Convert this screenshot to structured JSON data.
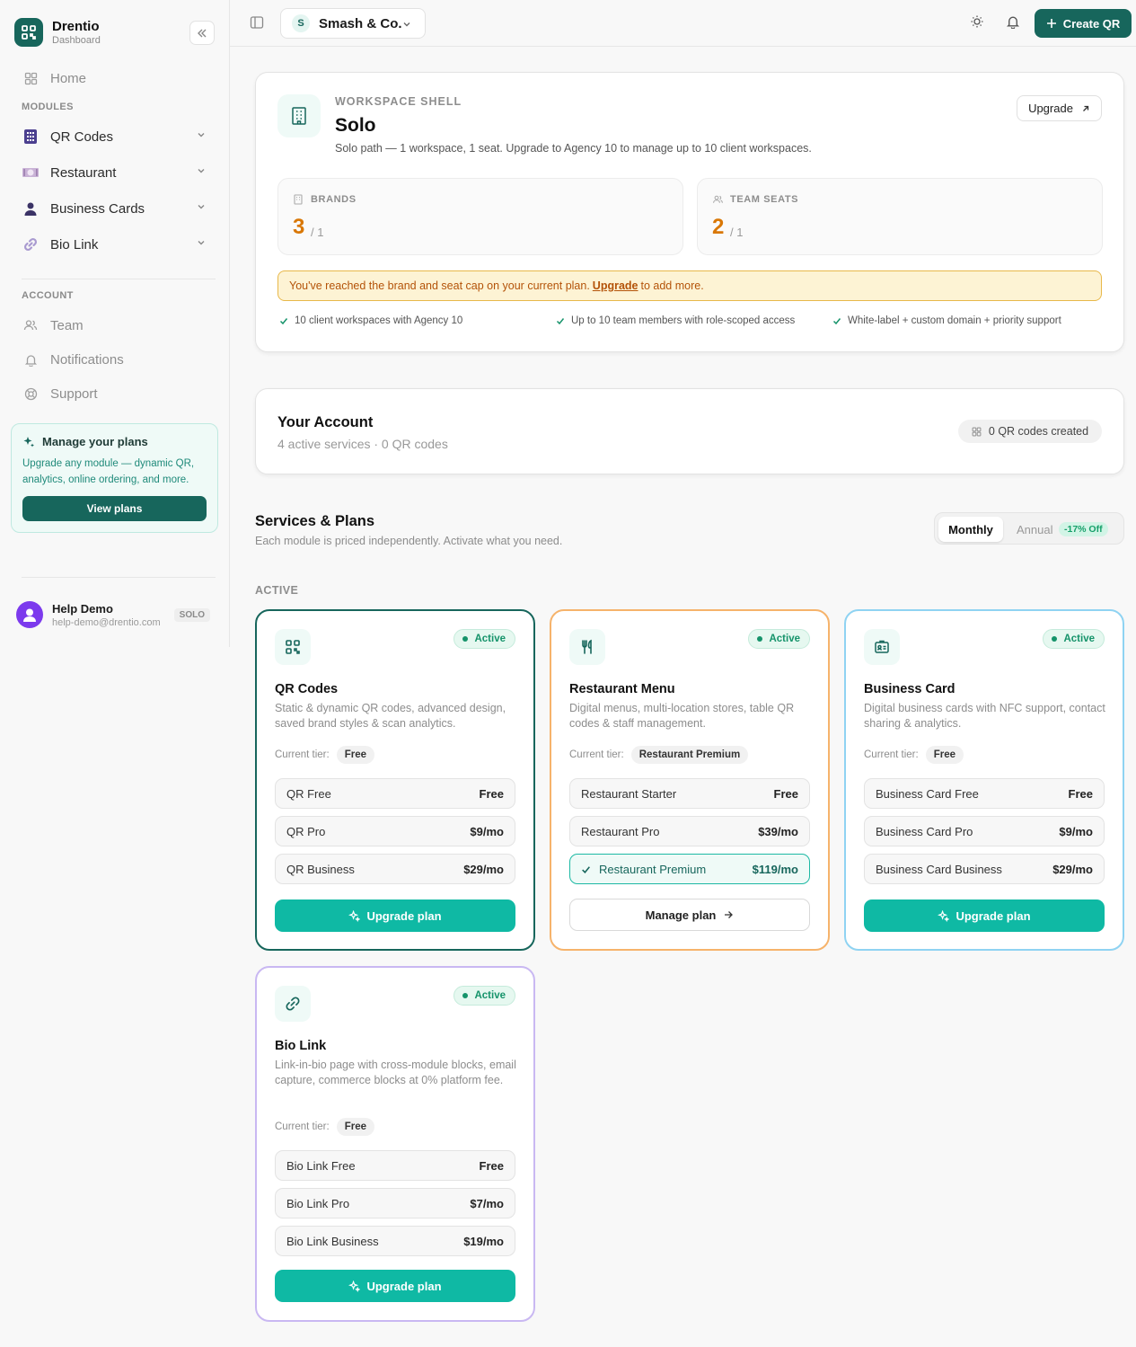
{
  "app": {
    "name": "Drentio",
    "subtitle": "Dashboard"
  },
  "sidebar": {
    "home": "Home",
    "modules_label": "MODULES",
    "modules": [
      {
        "label": "QR Codes",
        "icon": "qr-grid-icon"
      },
      {
        "label": "Restaurant",
        "icon": "plate-icon"
      },
      {
        "label": "Business Cards",
        "icon": "person-icon"
      },
      {
        "label": "Bio Link",
        "icon": "link-icon"
      }
    ],
    "account_label": "ACCOUNT",
    "account": [
      {
        "label": "Team",
        "icon": "users-icon"
      },
      {
        "label": "Notifications",
        "icon": "bell-icon"
      },
      {
        "label": "Support",
        "icon": "lifebuoy-icon"
      }
    ],
    "plans_card": {
      "title": "Manage your plans",
      "desc": "Upgrade any module — dynamic QR, analytics, online ordering, and more.",
      "button": "View plans"
    },
    "user": {
      "name": "Help Demo",
      "email": "help-demo@drentio.com",
      "badge": "SOLO"
    }
  },
  "topbar": {
    "workspace_initial": "S",
    "workspace_name": "Smash & Co.",
    "create_label": "Create QR"
  },
  "workspace": {
    "eyebrow": "WORKSPACE SHELL",
    "title": "Solo",
    "desc": "Solo path — 1 workspace, 1 seat. Upgrade to Agency 10 to manage up to 10 client workspaces.",
    "upgrade_label": "Upgrade",
    "brands": {
      "label": "BRANDS",
      "value": "3",
      "of": "/ 1"
    },
    "seats": {
      "label": "TEAM SEATS",
      "value": "2",
      "of": "/ 1"
    },
    "alert_pre": "You've reached the brand and seat cap on your current plan.",
    "alert_link": "Upgrade",
    "alert_post": "to add more.",
    "features": [
      "10 client workspaces with Agency 10",
      "Up to 10 team members with role-scoped access",
      "White-label + custom domain + priority support"
    ]
  },
  "account": {
    "title": "Your Account",
    "sub": "4 active services · 0 QR codes",
    "badge": "0 QR codes created"
  },
  "services": {
    "title": "Services & Plans",
    "sub": "Each module is priced independently. Activate what you need.",
    "monthly": "Monthly",
    "annual": "Annual",
    "discount": "-17% Off",
    "section_label": "ACTIVE",
    "tier_label": "Current tier:",
    "modules": [
      {
        "title": "QR Codes",
        "desc": "Static & dynamic QR codes, advanced design, saved brand styles & scan analytics.",
        "status": "Active",
        "tier": "Free",
        "accent": "#17665c",
        "plans": [
          {
            "name": "QR Free",
            "price": "Free"
          },
          {
            "name": "QR Pro",
            "price": "$9/mo"
          },
          {
            "name": "QR Business",
            "price": "$29/mo"
          }
        ],
        "button": "Upgrade plan"
      },
      {
        "title": "Restaurant Menu",
        "desc": "Digital menus, multi-location stores, table QR codes & staff management.",
        "status": "Active",
        "tier": "Restaurant Premium",
        "accent": "#f6b36b",
        "plans": [
          {
            "name": "Restaurant Starter",
            "price": "Free"
          },
          {
            "name": "Restaurant Pro",
            "price": "$39/mo"
          },
          {
            "name": "Restaurant Premium",
            "price": "$119/mo"
          }
        ],
        "button": "Manage plan"
      },
      {
        "title": "Business Card",
        "desc": "Digital business cards with NFC support, contact sharing & analytics.",
        "status": "Active",
        "tier": "Free",
        "accent": "#8fd3f2",
        "plans": [
          {
            "name": "Business Card Free",
            "price": "Free"
          },
          {
            "name": "Business Card Pro",
            "price": "$9/mo"
          },
          {
            "name": "Business Card Business",
            "price": "$29/mo"
          }
        ],
        "button": "Upgrade plan"
      },
      {
        "title": "Bio Link",
        "desc": "Link-in-bio page with cross-module blocks, email capture, commerce blocks at 0% platform fee.",
        "status": "Active",
        "tier": "Free",
        "accent": "#c9b8f2",
        "plans": [
          {
            "name": "Bio Link Free",
            "price": "Free"
          },
          {
            "name": "Bio Link Pro",
            "price": "$7/mo"
          },
          {
            "name": "Bio Link Business",
            "price": "$19/mo"
          }
        ],
        "button": "Upgrade plan"
      }
    ]
  }
}
